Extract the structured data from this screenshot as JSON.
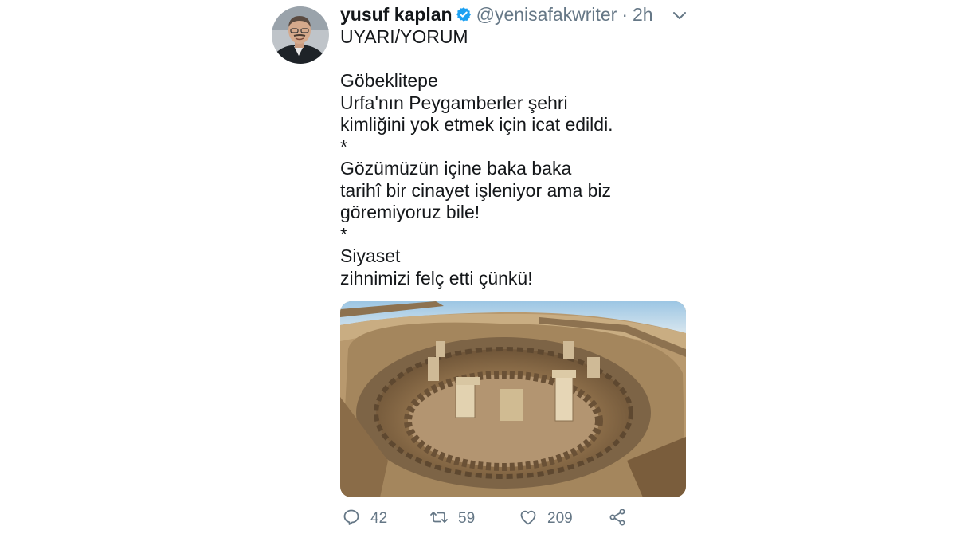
{
  "tweet": {
    "author": {
      "name": "yusuf kaplan",
      "handle": "@yenisafakwriter",
      "verified_icon": "verified-badge-icon",
      "avatar_icon": "profile-avatar"
    },
    "separator": "·",
    "time": "2h",
    "text_lines": [
      "UYARI/YORUM",
      "",
      "Göbeklitepe",
      "Urfa'nın Peygamberler şehri",
      "kimliğini yok etmek için icat edildi.",
      "*",
      "Gözümüzün içine baka baka",
      "tarihî bir cinayet işleniyor ama biz",
      "göremiyoruz bile!",
      "*",
      "Siyaset",
      "zihnimizi felç etti çünkü!"
    ],
    "media": {
      "type": "photo",
      "icon": "excavation-photo"
    },
    "actions": {
      "reply": {
        "icon": "reply-icon",
        "count": "42"
      },
      "retweet": {
        "icon": "retweet-icon",
        "count": "59"
      },
      "like": {
        "icon": "heart-icon",
        "count": "209"
      },
      "share": {
        "icon": "share-icon"
      }
    },
    "menu_icon": "chevron-down-icon"
  },
  "colors": {
    "text": "#14171a",
    "secondary": "#657786",
    "verified": "#1da1f2"
  }
}
